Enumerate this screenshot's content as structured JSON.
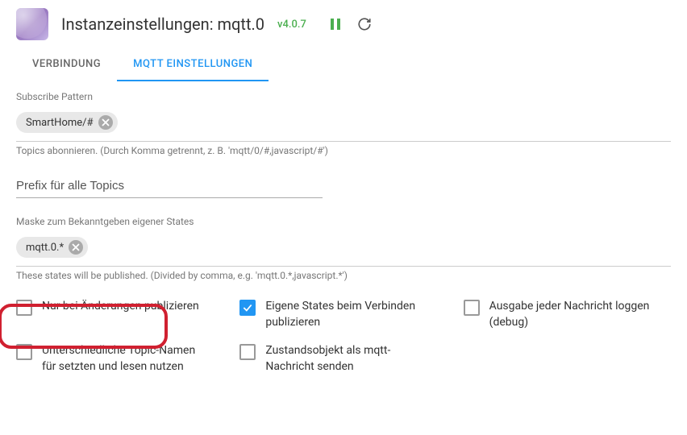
{
  "header": {
    "title": "Instanzeinstellungen: mqtt.0",
    "version": "v4.0.7"
  },
  "tabs": {
    "verbindung": "VERBINDUNG",
    "mqtt_einstellungen": "MQTT EINSTELLUNGEN"
  },
  "subscribe": {
    "label": "Subscribe Pattern",
    "chip": "SmartHome/#",
    "hint": "Topics abonnieren. (Durch Komma getrennt, z. B. 'mqtt/0/#,javascript/#')"
  },
  "prefix": {
    "placeholder": "Prefix für alle Topics"
  },
  "mask": {
    "label": "Maske zum Bekanntgeben eigener States",
    "chip": "mqtt.0.*",
    "hint": "These states will be published. (Divided by comma, e.g. 'mqtt.0.*,javascript.*')"
  },
  "checkboxes": {
    "onchange": "Nur bei Änderungen publizieren",
    "own_states": "Eigene States beim Verbinden publizieren",
    "debug": "Ausgabe jeder Nachricht loggen (debug)",
    "diff_topics": "Unterschiedliche Topic-Namen für setzten und lesen nutzen",
    "state_obj": "Zustandsobjekt als mqtt-Nachricht senden"
  }
}
